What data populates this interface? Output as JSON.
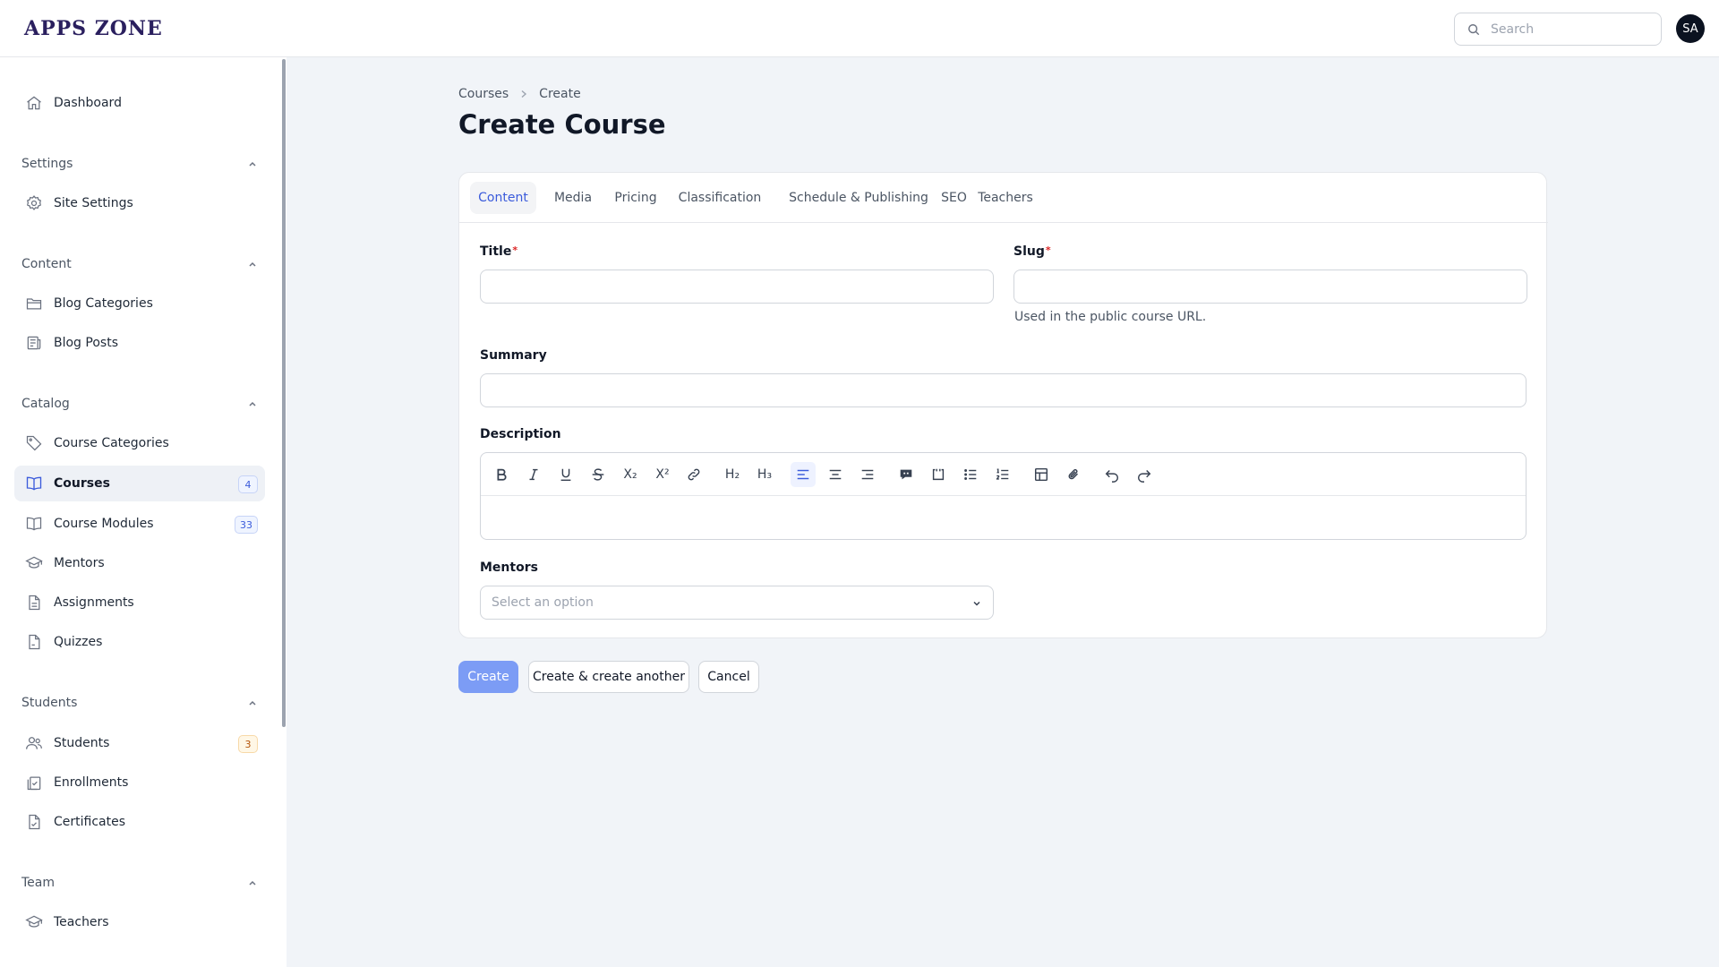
{
  "app": {
    "logo": "APPS ZONE"
  },
  "header": {
    "search_placeholder": "Search",
    "avatar_initials": "SA"
  },
  "sidebar": {
    "dashboard": "Dashboard",
    "groups": {
      "settings": {
        "label": "Settings",
        "items": [
          "Site Settings"
        ]
      },
      "content": {
        "label": "Content",
        "items": [
          "Blog Categories",
          "Blog Posts"
        ]
      },
      "catalog": {
        "label": "Catalog",
        "items": [
          "Course Categories",
          "Courses",
          "Course Modules",
          "Mentors",
          "Assignments",
          "Quizzes"
        ]
      },
      "students": {
        "label": "Students",
        "items": [
          "Students",
          "Enrollments",
          "Certificates"
        ]
      },
      "team": {
        "label": "Team",
        "items": [
          "Teachers"
        ]
      }
    },
    "badges": {
      "courses": "4",
      "course_modules": "33",
      "students": "3"
    },
    "active_item": "Courses"
  },
  "breadcrumb": {
    "parent": "Courses",
    "current": "Create"
  },
  "page": {
    "title": "Create Course"
  },
  "tabs": [
    "Content",
    "Media",
    "Pricing",
    "Classification",
    "Schedule & Publishing",
    "SEO",
    "Teachers"
  ],
  "form": {
    "title_label": "Title",
    "title_value": "",
    "slug_label": "Slug",
    "slug_value": "",
    "slug_hint": "Used in the public course URL.",
    "summary_label": "Summary",
    "summary_value": "",
    "description_label": "Description",
    "toolbar": {
      "subscript": "X₂",
      "superscript": "X²",
      "h2": "H₂",
      "h3": "H₃"
    },
    "mentors_label": "Mentors",
    "mentors_placeholder": "Select an option",
    "required_mark": "*"
  },
  "actions": {
    "create": "Create",
    "create_another": "Create & create another",
    "cancel": "Cancel"
  },
  "colors": {
    "primary": "#7c9cf5",
    "accent_text": "#3b5bdb",
    "required": "#dc2626",
    "background": "#f1f4f8"
  }
}
